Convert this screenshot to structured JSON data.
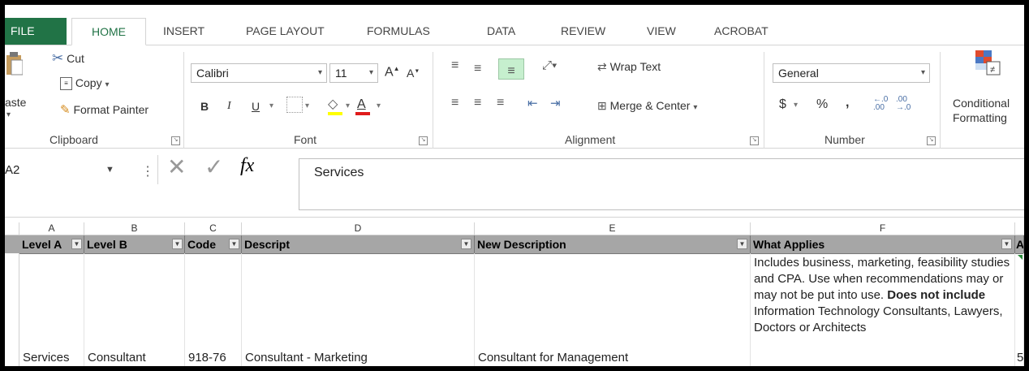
{
  "ribbon_tabs": [
    "FILE",
    "HOME",
    "INSERT",
    "PAGE LAYOUT",
    "FORMULAS",
    "DATA",
    "REVIEW",
    "VIEW",
    "ACROBAT"
  ],
  "clipboard": {
    "paste": "aste",
    "cut": "Cut",
    "copy": "Copy",
    "format_painter": "Format Painter",
    "label": "Clipboard"
  },
  "font": {
    "name": "Calibri",
    "size": "11",
    "bold": "B",
    "italic": "I",
    "underline": "U",
    "label": "Font"
  },
  "alignment": {
    "wrap_text": "Wrap Text",
    "merge_center": "Merge & Center",
    "label": "Alignment"
  },
  "number": {
    "format": "General",
    "currency": "$",
    "percent": "%",
    "comma": ",",
    "label": "Number"
  },
  "styles": {
    "conditional_1": "Conditional",
    "conditional_2": "Formatting"
  },
  "formula_bar": {
    "name_box": "A2",
    "fx": "fx",
    "value": "Services"
  },
  "columns": [
    "A",
    "B",
    "C",
    "D",
    "E",
    "F"
  ],
  "headers": [
    "Level A",
    "Level B",
    "Code",
    "Descript",
    "New Description",
    "What Applies",
    "A"
  ],
  "row": {
    "level_a": "Services",
    "level_b": "Consultant",
    "code": "918-76",
    "descript": "Consultant - Marketing",
    "new_description": "Consultant for Management",
    "what_applies_1": "Includes business, marketing, feasibility studies and CPA.  Use when recommendations may or may not be put into use.",
    "what_applies_bold": "Does not include",
    "what_applies_2": "Information Technology Consultants, Lawyers, Doctors or Architects",
    "next_col": "5"
  },
  "colors": {
    "file_tab": "#217346",
    "header_fill": "#a6a6a6"
  }
}
